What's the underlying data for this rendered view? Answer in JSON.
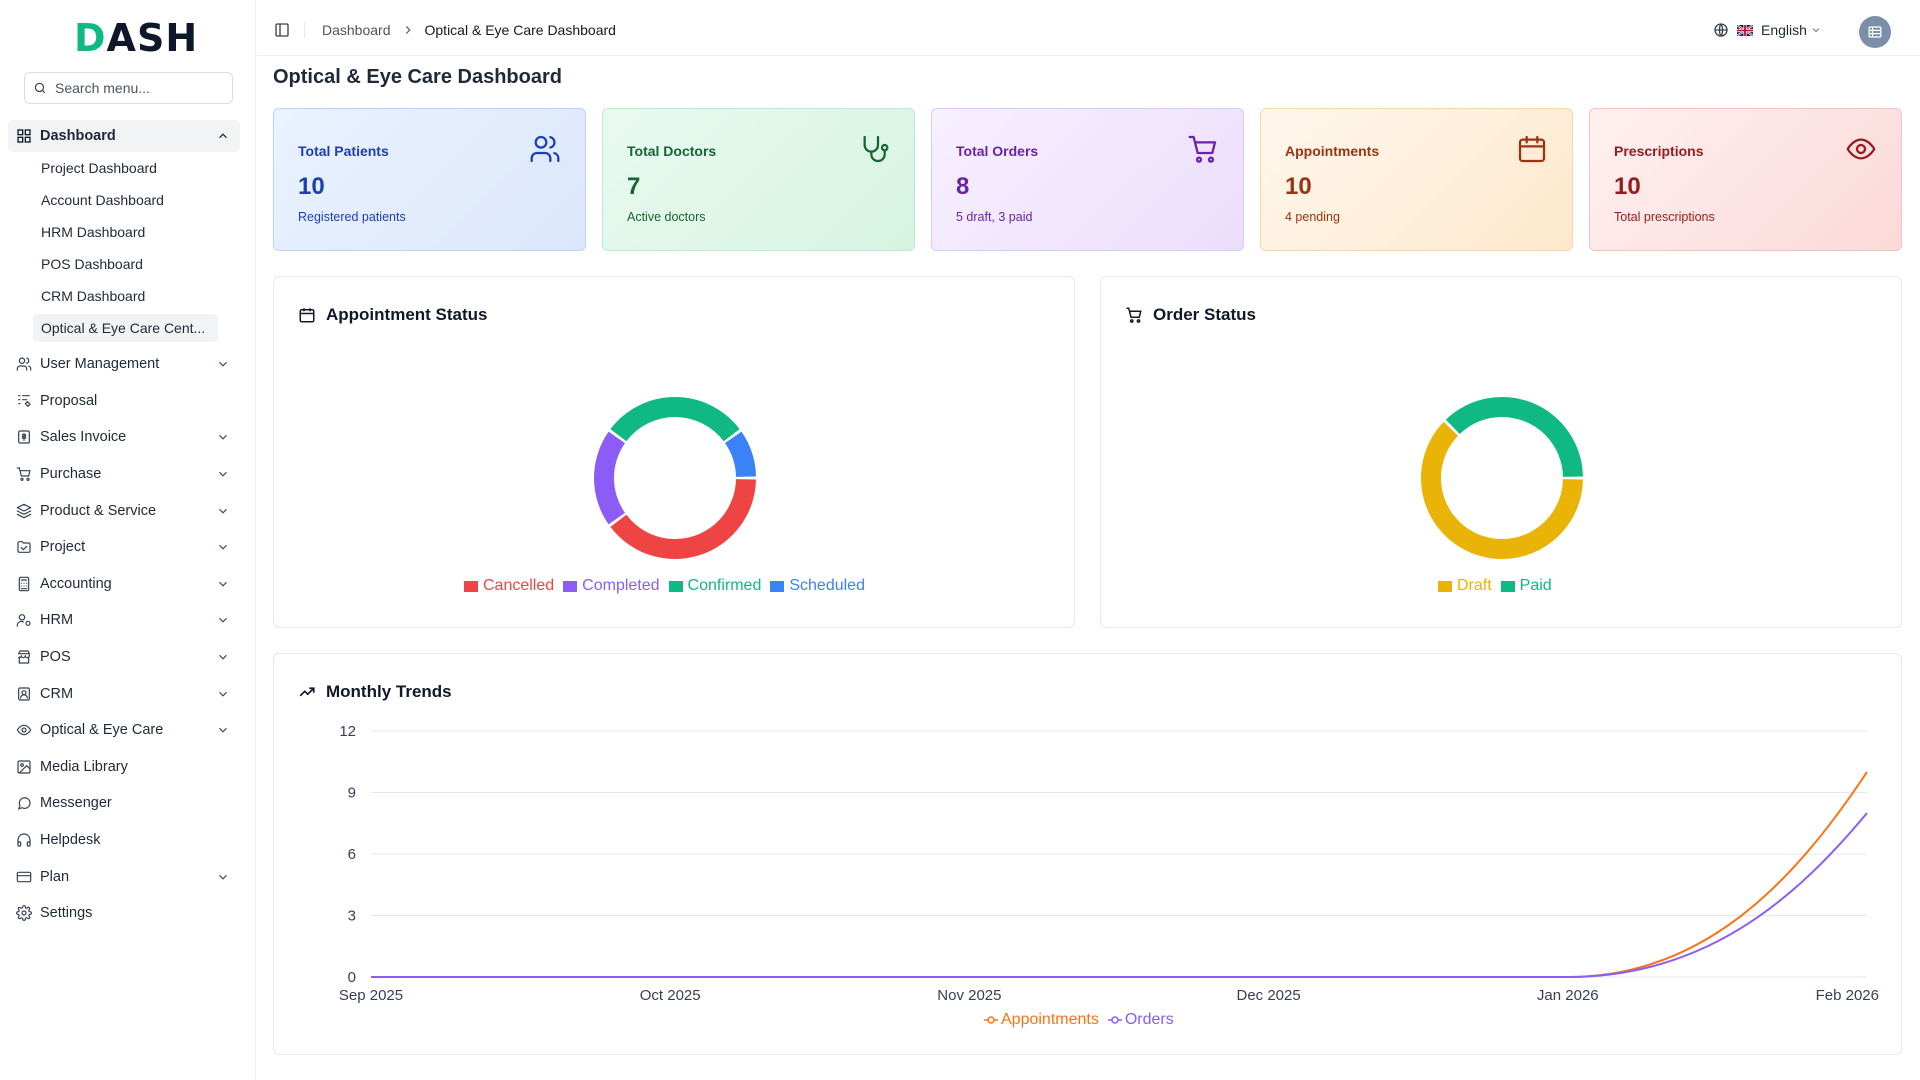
{
  "app": {
    "logo_text": "DASH"
  },
  "search": {
    "placeholder": "Search menu..."
  },
  "sidebar": {
    "dashboard": {
      "label": "Dashboard",
      "icon": "grid-icon"
    },
    "sub_items": [
      {
        "label": "Project Dashboard"
      },
      {
        "label": "Account Dashboard"
      },
      {
        "label": "HRM Dashboard"
      },
      {
        "label": "POS Dashboard"
      },
      {
        "label": "CRM Dashboard"
      },
      {
        "label": "Optical & Eye Care Cent..."
      }
    ],
    "items": [
      {
        "label": "User Management",
        "icon": "users-icon",
        "chevron": true
      },
      {
        "label": "Proposal",
        "icon": "proposal-icon",
        "chevron": false
      },
      {
        "label": "Sales Invoice",
        "icon": "invoice-icon",
        "chevron": true
      },
      {
        "label": "Purchase",
        "icon": "cart-icon",
        "chevron": true
      },
      {
        "label": "Product & Service",
        "icon": "layers-icon",
        "chevron": true
      },
      {
        "label": "Project",
        "icon": "folder-icon",
        "chevron": true
      },
      {
        "label": "Accounting",
        "icon": "calculator-icon",
        "chevron": true
      },
      {
        "label": "HRM",
        "icon": "user-cog-icon",
        "chevron": true
      },
      {
        "label": "POS",
        "icon": "store-icon",
        "chevron": true
      },
      {
        "label": "CRM",
        "icon": "contact-icon",
        "chevron": true
      },
      {
        "label": "Optical & Eye Care",
        "icon": "eye-icon",
        "chevron": true
      },
      {
        "label": "Media Library",
        "icon": "image-icon",
        "chevron": false
      },
      {
        "label": "Messenger",
        "icon": "message-icon",
        "chevron": false
      },
      {
        "label": "Helpdesk",
        "icon": "headphones-icon",
        "chevron": false
      },
      {
        "label": "Plan",
        "icon": "credit-card-icon",
        "chevron": true
      },
      {
        "label": "Settings",
        "icon": "gear-icon",
        "chevron": false
      }
    ]
  },
  "header": {
    "breadcrumb": [
      "Dashboard",
      "Optical & Eye Care Dashboard"
    ],
    "language": "English"
  },
  "main": {
    "title": "Optical & Eye Care Dashboard"
  },
  "cards": [
    {
      "label": "Total Patients",
      "value": "10",
      "sub": "Registered patients",
      "icon": "users-icon",
      "color": "#1e40af"
    },
    {
      "label": "Total Doctors",
      "value": "7",
      "sub": "Active doctors",
      "icon": "stethoscope-icon",
      "color": "#166534"
    },
    {
      "label": "Total Orders",
      "value": "8",
      "sub": "5 draft, 3 paid",
      "icon": "cart-icon",
      "color": "#6b21a8"
    },
    {
      "label": "Appointments",
      "value": "10",
      "sub": "4 pending",
      "icon": "calendar-icon",
      "color": "#9a3412"
    },
    {
      "label": "Prescriptions",
      "value": "10",
      "sub": "Total prescriptions",
      "icon": "eye-icon",
      "color": "#991b1b"
    }
  ],
  "panels": {
    "appointment_status": "Appointment Status",
    "order_status": "Order Status",
    "monthly_trends": "Monthly Trends"
  },
  "chart_data": [
    {
      "type": "pie",
      "title": "Appointment Status",
      "categories": [
        "Cancelled",
        "Completed",
        "Confirmed",
        "Scheduled"
      ],
      "values": [
        4,
        2,
        3,
        1
      ],
      "colors": [
        "#ef4444",
        "#8b5cf6",
        "#10b981",
        "#3b82f6"
      ],
      "legend": "bottom"
    },
    {
      "type": "pie",
      "title": "Order Status",
      "categories": [
        "Draft",
        "Paid"
      ],
      "values": [
        5,
        3
      ],
      "colors": [
        "#eab308",
        "#10b981"
      ],
      "legend": "bottom"
    },
    {
      "type": "line",
      "title": "Monthly Trends",
      "x": [
        "Sep 2025",
        "Oct 2025",
        "Nov 2025",
        "Dec 2025",
        "Jan 2026",
        "Feb 2026"
      ],
      "series": [
        {
          "name": "Appointments",
          "values": [
            0,
            0,
            0,
            0,
            0,
            10
          ],
          "color": "#f97316"
        },
        {
          "name": "Orders",
          "values": [
            0,
            0,
            0,
            0,
            0,
            8
          ],
          "color": "#8b5cf6"
        }
      ],
      "ylim": [
        0,
        12
      ],
      "yticks": [
        0,
        3,
        6,
        9,
        12
      ],
      "grid": true,
      "legend": "bottom"
    }
  ]
}
